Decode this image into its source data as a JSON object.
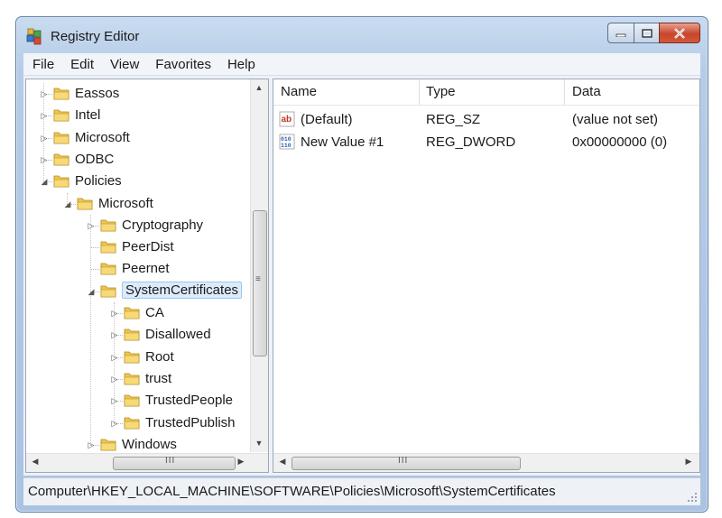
{
  "window": {
    "title": "Registry Editor"
  },
  "menu": [
    "File",
    "Edit",
    "View",
    "Favorites",
    "Help"
  ],
  "tree": [
    {
      "label": "Eassos",
      "level": 0,
      "expander": "collapsed"
    },
    {
      "label": "Intel",
      "level": 0,
      "expander": "collapsed"
    },
    {
      "label": "Microsoft",
      "level": 0,
      "expander": "collapsed"
    },
    {
      "label": "ODBC",
      "level": 0,
      "expander": "collapsed"
    },
    {
      "label": "Policies",
      "level": 0,
      "expander": "expanded"
    },
    {
      "label": "Microsoft",
      "level": 1,
      "expander": "expanded"
    },
    {
      "label": "Cryptography",
      "level": 2,
      "expander": "collapsed"
    },
    {
      "label": "PeerDist",
      "level": 2,
      "expander": "none"
    },
    {
      "label": "Peernet",
      "level": 2,
      "expander": "none"
    },
    {
      "label": "SystemCertificates",
      "level": 2,
      "expander": "expanded",
      "selected": true
    },
    {
      "label": "CA",
      "level": 3,
      "expander": "collapsed"
    },
    {
      "label": "Disallowed",
      "level": 3,
      "expander": "collapsed"
    },
    {
      "label": "Root",
      "level": 3,
      "expander": "collapsed"
    },
    {
      "label": "trust",
      "level": 3,
      "expander": "collapsed"
    },
    {
      "label": "TrustedPeople",
      "level": 3,
      "expander": "collapsed"
    },
    {
      "label": "TrustedPublish",
      "level": 3,
      "expander": "collapsed"
    },
    {
      "label": "Windows",
      "level": 2,
      "expander": "collapsed"
    }
  ],
  "list": {
    "columns": [
      "Name",
      "Type",
      "Data"
    ],
    "rows": [
      {
        "name": "(Default)",
        "type": "REG_SZ",
        "data": "(value not set)",
        "icon": "string-value-icon"
      },
      {
        "name": "New Value #1",
        "type": "REG_DWORD",
        "data": "0x00000000 (0)",
        "icon": "binary-value-icon"
      }
    ]
  },
  "status": {
    "path": "Computer\\HKEY_LOCAL_MACHINE\\SOFTWARE\\Policies\\Microsoft\\SystemCertificates"
  },
  "scrollbar": {
    "grip": "III",
    "grip_v": "≡"
  },
  "colors": {
    "selection": "#dcebfb",
    "folder": "#f0c64a",
    "close": "#c9452a"
  }
}
